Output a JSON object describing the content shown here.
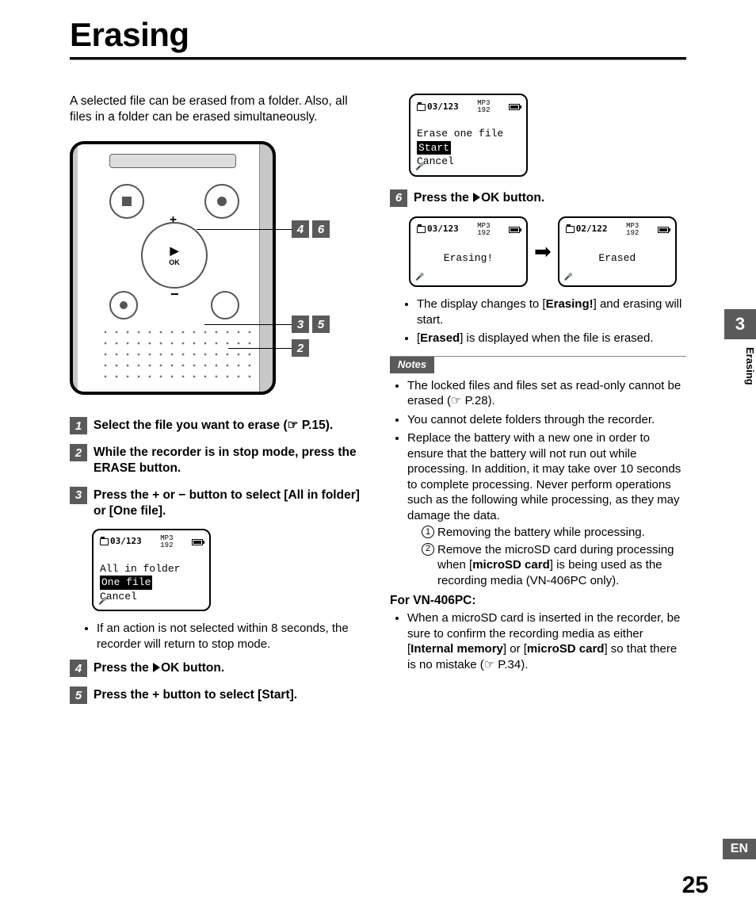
{
  "title": "Erasing",
  "intro": "A selected file can be erased from a folder. Also, all files in a folder can be erased simultaneously.",
  "device": {
    "callouts": {
      "pair_top": [
        "4",
        "6"
      ],
      "pair_mid": [
        "3",
        "5"
      ],
      "single": "2"
    },
    "nav_ok": "OK",
    "nav_prev": "◂◂",
    "nav_next": "▸▸"
  },
  "steps": {
    "s1_a": "Select the file you want to erase (☞ P.15).",
    "s2_a": "While the recorder is in stop mode, press the ",
    "s2_b": "ERASE",
    "s2_c": " button.",
    "s3_a": "Press the + or − button to select [",
    "s3_b": "All in folder",
    "s3_c": "] or [",
    "s3_d": "One file",
    "s3_e": "].",
    "s4_a": "Press the ",
    "s4_b": "OK",
    "s4_c": " button.",
    "s5_a": "Press the + button to select [",
    "s5_b": "Start",
    "s5_c": "].",
    "s6_a": "Press the ",
    "s6_b": "OK",
    "s6_c": " button."
  },
  "lcd1": {
    "folder": "A",
    "counter": "03/123",
    "fmt": "MP3",
    "rate": "192",
    "line1": "All in folder",
    "line2_sel": "One file",
    "line3": "Cancel"
  },
  "step3_note": "If an action is not selected within 8 seconds, the recorder will return to stop mode.",
  "lcd2": {
    "folder": "A",
    "counter": "03/123",
    "fmt": "MP3",
    "rate": "192",
    "line1": "Erase one file",
    "line2_sel": "Start",
    "line3": "Cancel"
  },
  "lcd3a": {
    "folder": "A",
    "counter": "03/123",
    "fmt": "MP3",
    "rate": "192",
    "center": "Erasing!"
  },
  "lcd3b": {
    "folder": "A",
    "counter": "02/122",
    "fmt": "MP3",
    "rate": "192",
    "center": "Erased"
  },
  "result_bullets": {
    "b1_a": "The display changes to [",
    "b1_b": "Erasing!",
    "b1_c": "] and erasing will start.",
    "b2_a": "[",
    "b2_b": "Erased",
    "b2_c": "] is displayed when the file is erased."
  },
  "notes_label": "Notes",
  "notes": {
    "n1": "The locked files and files set as read-only cannot be erased (☞ P.28).",
    "n2": "You cannot delete folders through the recorder.",
    "n3": "Replace the battery with a new one in order to ensure that the battery will not run out while processing. In addition, it may take over 10 seconds to complete processing. Never perform operations such as the following while processing, as they may damage the data.",
    "n3_1": "Removing the battery while processing.",
    "n3_2_a": "Remove the microSD card during processing when [",
    "n3_2_b": "microSD card",
    "n3_2_c": "] is being used as the recording media (VN-406PC only)."
  },
  "for_model": "For VN-406PC:",
  "for_model_bullet_a": "When a microSD card is inserted in the recorder, be sure to confirm the recording media as either [",
  "for_model_bullet_b": "Internal memory",
  "for_model_bullet_c": "] or [",
  "for_model_bullet_d": "microSD card",
  "for_model_bullet_e": "] so that there is no mistake (☞ P.34).",
  "side": {
    "chapter": "3",
    "label": "Erasing",
    "lang": "EN",
    "page": "25"
  }
}
